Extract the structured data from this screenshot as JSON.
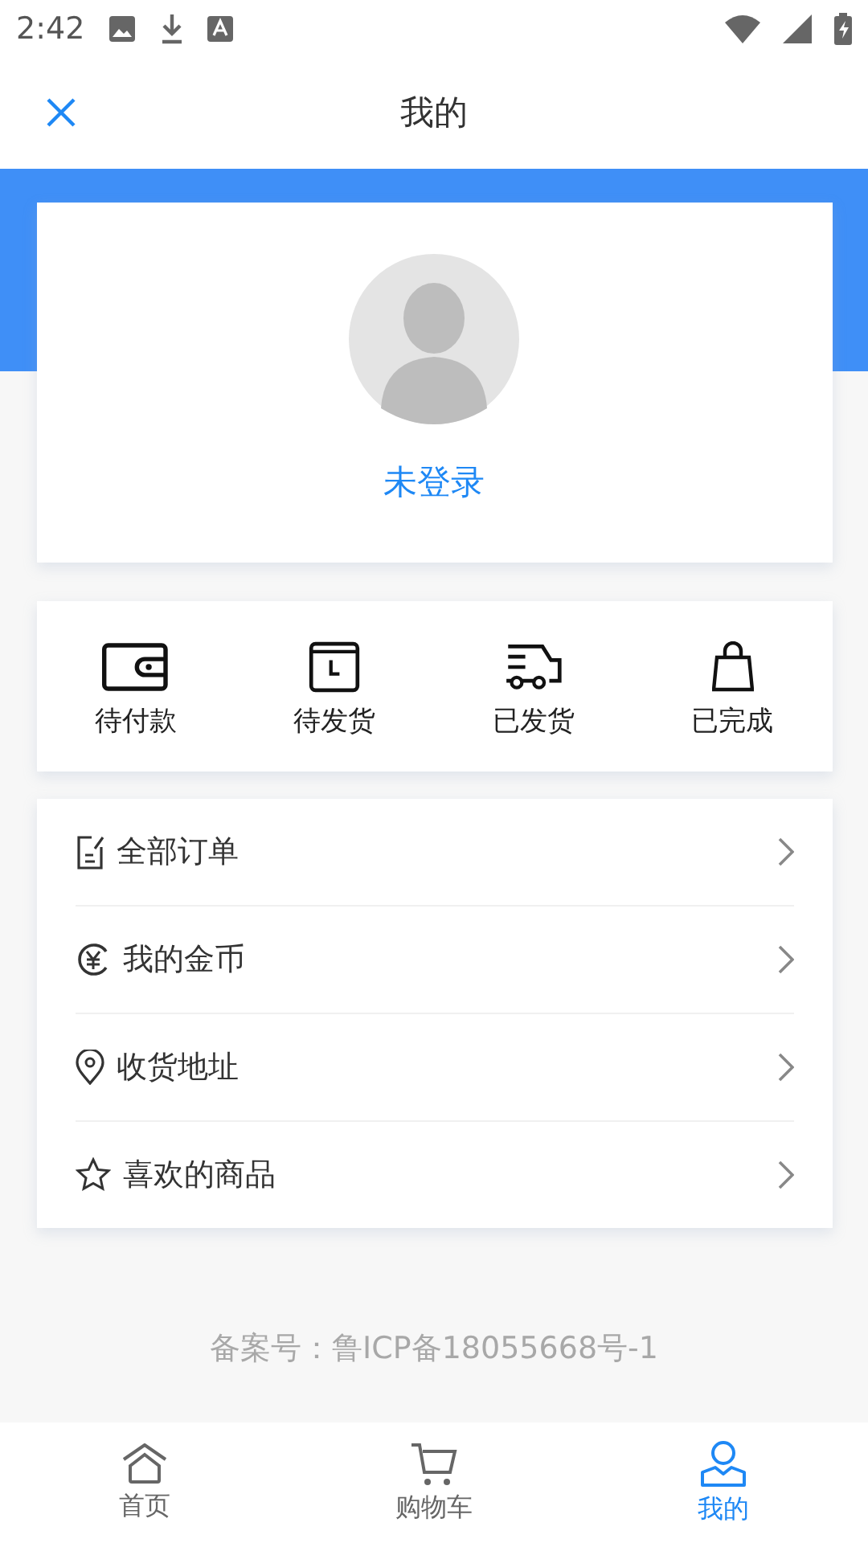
{
  "status_bar": {
    "time": "2:42"
  },
  "header": {
    "title": "我的"
  },
  "profile": {
    "login_text": "未登录"
  },
  "order_status": [
    {
      "label": "待付款"
    },
    {
      "label": "待发货"
    },
    {
      "label": "已发货"
    },
    {
      "label": "已完成"
    }
  ],
  "menu": [
    {
      "label": "全部订单"
    },
    {
      "label": "我的金币"
    },
    {
      "label": "收货地址"
    },
    {
      "label": "喜欢的商品"
    }
  ],
  "footer": {
    "icp": "备案号：鲁ICP备18055668号-1"
  },
  "tab_bar": [
    {
      "label": "首页",
      "selected": false
    },
    {
      "label": "购物车",
      "selected": false
    },
    {
      "label": "我的",
      "selected": true
    }
  ]
}
